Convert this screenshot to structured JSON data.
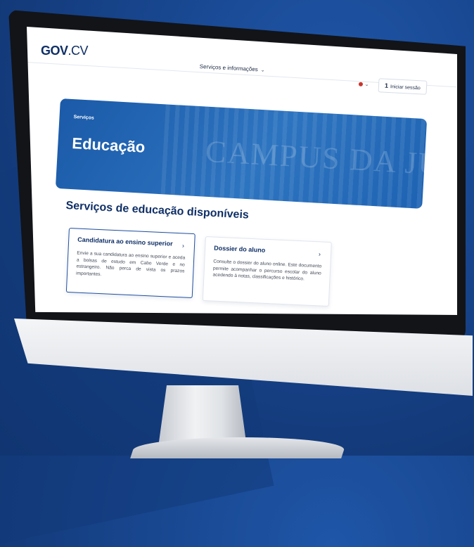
{
  "header": {
    "logo_main": "GOV",
    "logo_suffix": ".CV",
    "nav_menu_label": "Serviços e informações",
    "login_label": "Iniciar sessão"
  },
  "hero": {
    "breadcrumb": "Serviços",
    "title": "Educação",
    "background_text": "CAMPUS DA JUSTIÇA"
  },
  "section": {
    "title": "Serviços de educação disponíveis"
  },
  "cards": [
    {
      "title": "Candidatura ao ensino superior",
      "description": "Envie a sua candidatura ao ensino superior e aceda a bolsas de estudo em Cabo Verde e no estrangeiro. Não perca de vista os prazos importantes."
    },
    {
      "title": "Dossier do aluno",
      "description": "Consulte o dossier do aluno online. Este documento permite acompanhar o percurso escolar do aluno acedendo à notas, classificações e histórico."
    }
  ],
  "colors": {
    "brand_navy": "#0f2f66",
    "hero_blue": "#1e63b3",
    "background": "#17448b"
  },
  "icons": {
    "chevron": "chevron-down-icon",
    "user": "user-icon",
    "arrow": "arrow-right-icon",
    "flag": "flag-icon"
  }
}
